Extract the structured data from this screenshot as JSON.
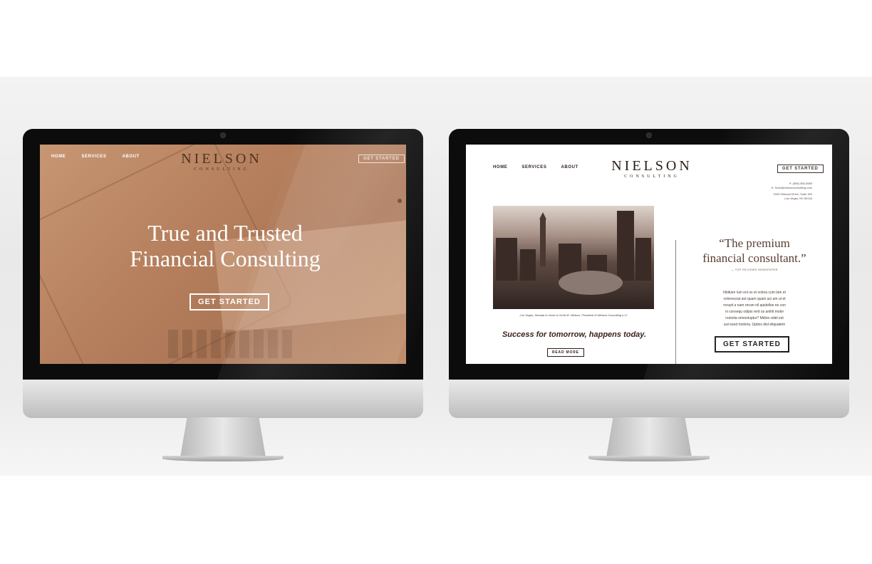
{
  "left_site": {
    "nav": [
      "HOME",
      "SERVICES",
      "ABOUT"
    ],
    "logo": {
      "name": "NIELSON",
      "sub": "CONSULTING"
    },
    "top_button": "GET STARTED",
    "headline_line1": "True and Trusted",
    "headline_line2": "Financial Consulting",
    "cta": "GET STARTED"
  },
  "right_site": {
    "nav": [
      "HOME",
      "SERVICES",
      "ABOUT"
    ],
    "logo": {
      "name": "NIELSON",
      "sub": "CONSULTING"
    },
    "top_button": "GET STARTED",
    "contact": {
      "phone": "P: (555) 555-5555",
      "email": "E: Scott@nielsonconsulting.com",
      "address1": "1500 Hillwood Drive, Suite 300",
      "address2": "Las Vegas, NV 89134"
    },
    "photo_caption": "Los Vegas, Nevada is home to Scott M. Nielson, President of Nielson Consulting LLC",
    "tagline": "Success for tomorrow, happens today.",
    "read_more": "READ MORE",
    "quote_line1": "“The premium",
    "quote_line2": "financial consultant.”",
    "quote_source": "— TOP REVIEWS NEWSPAPER",
    "body_lines": [
      "hibitiam lum oni os et volora cum lam et",
      "voloresciat aut quam quam aci am ut et",
      "rerspit a nam rerum nil quidellse ne con",
      "ni consequ odipis rerit os anihil molor",
      "restotia ommoluptur? Mdios cidel est",
      "aut esed moloria. Uptios dist eliquatem"
    ],
    "cta": "GET STARTED"
  },
  "colors": {
    "hero_overlay": "#b6805e",
    "brand_dark": "#2b1d16",
    "tagline": "#3a231a"
  }
}
